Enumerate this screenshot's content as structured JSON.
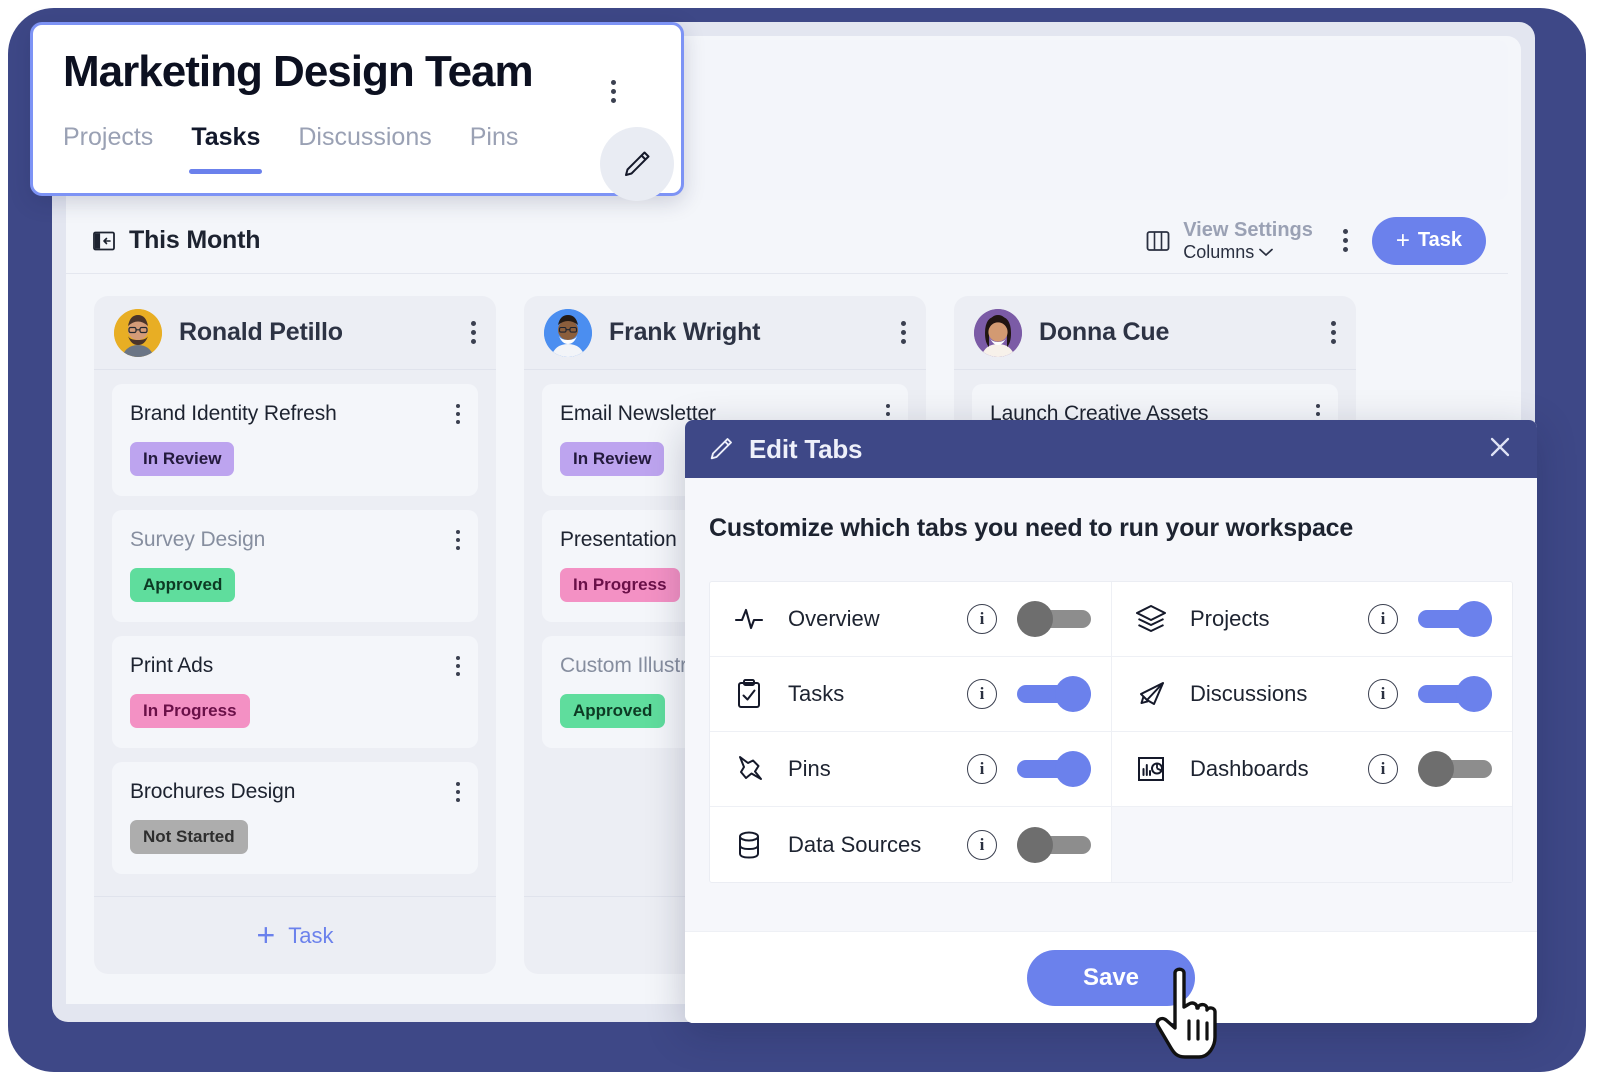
{
  "workspace": {
    "title": "Marketing Design Team",
    "kebab_icon": "kebab-menu-icon",
    "edit_icon": "pencil-icon",
    "tabs": [
      {
        "label": "Projects",
        "active": false
      },
      {
        "label": "Tasks",
        "active": true
      },
      {
        "label": "Discussions",
        "active": false
      },
      {
        "label": "Pins",
        "active": false
      }
    ]
  },
  "toolbar": {
    "collapse_icon": "collapse-panel-left-icon",
    "title": "This Month",
    "columns_icon": "columns-layout-icon",
    "view_settings_label": "View Settings",
    "view_settings_value": "Columns",
    "chevron": "⌄",
    "kebab_icon": "kebab-menu-icon",
    "add_task_label": "Task",
    "add_task_plus": "+"
  },
  "board": {
    "add_task_label": "Task",
    "columns": [
      {
        "name": "Ronald Petillo",
        "avatar_color": "#e8ae24",
        "cards": [
          {
            "title": "Brand Identity Refresh",
            "muted": false,
            "status": "In Review",
            "status_class": "b-review"
          },
          {
            "title": "Survey Design",
            "muted": true,
            "status": "Approved",
            "status_class": "b-approved"
          },
          {
            "title": "Print Ads",
            "muted": false,
            "status": "In Progress",
            "status_class": "b-progress"
          },
          {
            "title": "Brochures Design",
            "muted": false,
            "status": "Not Started",
            "status_class": "b-notstart"
          }
        ]
      },
      {
        "name": "Frank Wright",
        "avatar_color": "#4b8ef0",
        "cards": [
          {
            "title": "Email Newsletter",
            "muted": false,
            "status": "In Review",
            "status_class": "b-review"
          },
          {
            "title": "Presentation",
            "muted": false,
            "status": "In Progress",
            "status_class": "b-progress"
          },
          {
            "title": "Custom Illustration",
            "muted": true,
            "status": "Approved",
            "status_class": "b-approved"
          }
        ]
      },
      {
        "name": "Donna Cue",
        "avatar_color": "#7b5ba6",
        "cards": [
          {
            "title": "Launch Creative Assets",
            "muted": false,
            "status": "",
            "status_class": ""
          }
        ]
      }
    ]
  },
  "modal": {
    "header_icon": "pencil-icon",
    "title": "Edit Tabs",
    "close_icon": "close-icon",
    "subtitle": "Customize which tabs you need to run your workspace",
    "info_glyph": "i",
    "save_label": "Save",
    "accent_color": "#6b81ec",
    "toggle_off_color": "#8d8d8d",
    "header_color": "#3e4887",
    "rows_left": [
      {
        "icon": "activity-pulse-icon",
        "label": "Overview",
        "enabled": false
      },
      {
        "icon": "clipboard-check-icon",
        "label": "Tasks",
        "enabled": true
      },
      {
        "icon": "pushpin-icon",
        "label": "Pins",
        "enabled": true
      },
      {
        "icon": "database-icon",
        "label": "Data Sources",
        "enabled": false
      }
    ],
    "rows_right": [
      {
        "icon": "layers-icon",
        "label": "Projects",
        "enabled": true
      },
      {
        "icon": "megaphone-icon",
        "label": "Discussions",
        "enabled": true
      },
      {
        "icon": "chart-report-icon",
        "label": "Dashboards",
        "enabled": false
      }
    ]
  },
  "cursor": {
    "icon": "pointing-hand-cursor"
  }
}
